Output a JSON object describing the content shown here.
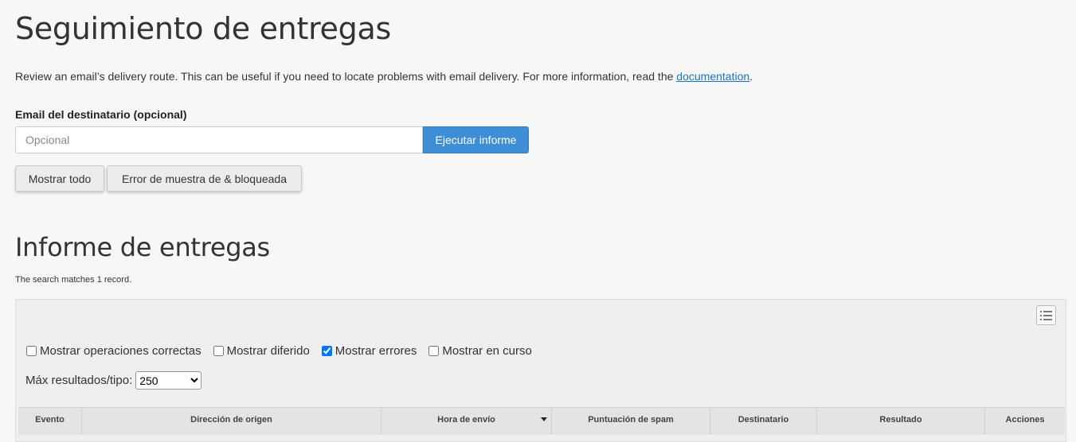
{
  "page": {
    "title": "Seguimiento de entregas",
    "intro_text": "Review an email’s delivery route. This can be useful if you need to locate problems with email delivery. For more information, read the ",
    "intro_link": "documentation",
    "intro_end": "."
  },
  "search": {
    "label": "Email del destinatario (opcional)",
    "placeholder": "Opcional",
    "value": "",
    "run_button": "Ejecutar informe",
    "show_all_button": "Mostrar todo",
    "show_errors_button": "Error de muestra de & bloqueada"
  },
  "report": {
    "title": "Informe de entregas",
    "matches_text": "The search matches 1 record.",
    "filters": [
      {
        "label": "Mostrar operaciones correctas",
        "checked": false
      },
      {
        "label": "Mostrar diferido",
        "checked": false
      },
      {
        "label": "Mostrar errores",
        "checked": true
      },
      {
        "label": "Mostrar en curso",
        "checked": false
      }
    ],
    "max_results_label": "Máx resultados/tipo:",
    "max_results_value": "250",
    "columns": [
      {
        "label": "Evento",
        "sorted": false
      },
      {
        "label": "Dirección de origen",
        "sorted": false
      },
      {
        "label": "Hora de envío",
        "sorted": true
      },
      {
        "label": "Puntuación de spam",
        "sorted": false
      },
      {
        "label": "Destinatario",
        "sorted": false
      },
      {
        "label": "Resultado",
        "sorted": false
      },
      {
        "label": "Acciones",
        "sorted": false
      }
    ]
  },
  "colors": {
    "accent": "#3d8ed6",
    "link": "#1a73c8",
    "background": "#f7f7f7"
  },
  "icons": {
    "columns_toggle": "list-icon",
    "sort": "caret-down-icon"
  }
}
